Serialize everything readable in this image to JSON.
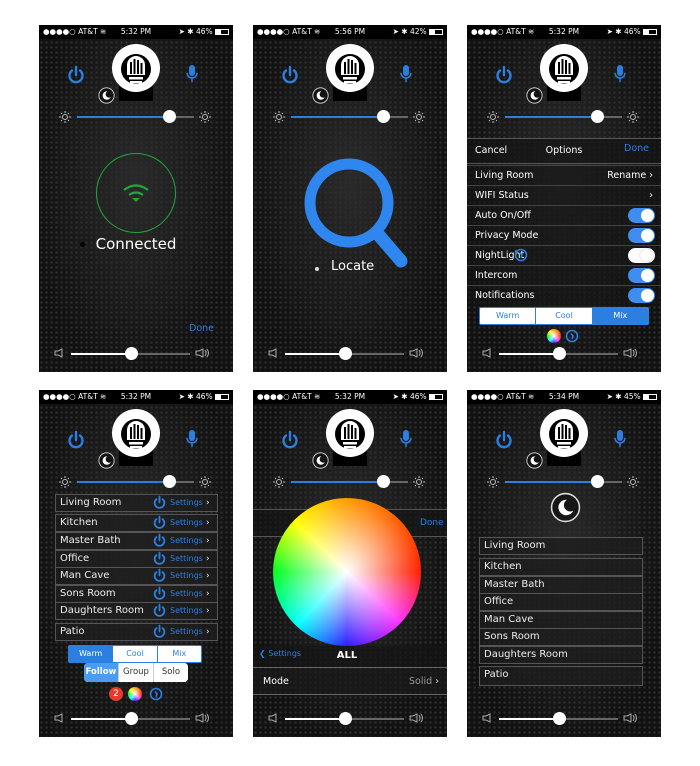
{
  "colors": {
    "accent": "#2b7fe0",
    "connected": "#1fa83a",
    "badge": "#e8392a"
  },
  "panels": [
    {
      "status": {
        "carrier": "AT&T",
        "time": "5:32 PM",
        "battery": "46%"
      },
      "brightness": 0.79,
      "volume": 0.5,
      "wifi": {
        "label": "Connected",
        "icon": "wifi-icon"
      },
      "done": "Done"
    },
    {
      "status": {
        "carrier": "AT&T",
        "time": "5:56 PM",
        "battery": "42%"
      },
      "brightness": 0.79,
      "volume": 0.5,
      "locate": {
        "label": "Locate",
        "icon": "search-icon"
      }
    },
    {
      "status": {
        "carrier": "AT&T",
        "time": "5:32 PM",
        "battery": "46%"
      },
      "brightness": 0.79,
      "volume": 0.5,
      "options": {
        "cancel": "Cancel",
        "title": "Options",
        "done": "Done",
        "rows": [
          {
            "label": "Living Room",
            "value": "Rename",
            "type": "link"
          },
          {
            "label": "WIFI Status",
            "value": "",
            "type": "link"
          },
          {
            "label": "Auto On/Off",
            "type": "toggle",
            "on": true
          },
          {
            "label": "Privacy Mode",
            "type": "toggle",
            "on": true
          },
          {
            "label": "NightLight",
            "type": "toggle",
            "on": false
          },
          {
            "label": "Intercom",
            "type": "toggle",
            "on": true
          },
          {
            "label": "Notifications",
            "type": "toggle",
            "on": true
          }
        ],
        "tone": [
          "Warm",
          "Cool",
          "Mix"
        ],
        "tone_selected": "Mix"
      }
    },
    {
      "status": {
        "carrier": "AT&T",
        "time": "5:32 PM",
        "battery": "46%"
      },
      "brightness": 0.79,
      "volume": 0.5,
      "rooms": [
        "Living Room",
        "Kitchen",
        "Master Bath",
        "Office",
        "Man Cave",
        "Sons Room",
        "Daughters Room",
        "Patio"
      ],
      "settings_label": "Settings",
      "tone": [
        "Warm",
        "Cool",
        "Mix"
      ],
      "tone_selected": "Warm",
      "mode": [
        "Follow",
        "Group",
        "Solo"
      ],
      "mode_selected": "Follow",
      "badge": "2"
    },
    {
      "status": {
        "carrier": "AT&T",
        "time": "5:32 PM",
        "battery": "46%"
      },
      "brightness": 0.79,
      "volume": 0.5,
      "done": "Done",
      "back": "Settings",
      "target": "ALL",
      "mode_label": "Mode",
      "mode_value": "Solid"
    },
    {
      "status": {
        "carrier": "AT&T",
        "time": "5:34 PM",
        "battery": "45%"
      },
      "brightness": 0.79,
      "volume": 0.5,
      "rooms": [
        "Living Room",
        "Kitchen",
        "Master Bath",
        "Office",
        "Man Cave",
        "Sons Room",
        "Daughters Room",
        "Patio"
      ]
    }
  ]
}
